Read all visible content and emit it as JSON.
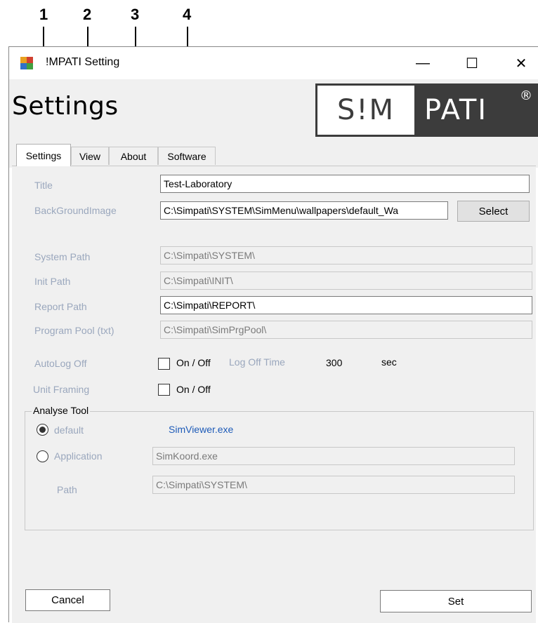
{
  "callouts": [
    "1",
    "2",
    "3",
    "4"
  ],
  "window": {
    "title": "!MPATI  Setting",
    "minimize": "—",
    "maximize": "☐",
    "close": "✕"
  },
  "header": {
    "title": "Settings",
    "logo_left": "S!M",
    "logo_right": "PATI",
    "logo_reg": "®"
  },
  "tabs": [
    "Settings",
    "View",
    "About",
    "Software"
  ],
  "form": {
    "title_label": "Title",
    "title_value": "Test-Laboratory",
    "bg_label": "BackGroundImage",
    "bg_value": "C:\\Simpati\\SYSTEM\\SimMenu\\wallpapers\\default_Wa",
    "select_button": "Select",
    "system_path_label": "System Path",
    "system_path_value": "C:\\Simpati\\SYSTEM\\",
    "init_path_label": "Init Path",
    "init_path_value": "C:\\Simpati\\INIT\\",
    "report_path_label": "Report Path",
    "report_path_value": "C:\\Simpati\\REPORT\\",
    "program_pool_label": "Program Pool (txt)",
    "program_pool_value": "C:\\Simpati\\SimPrgPool\\",
    "autolog_label": "AutoLog Off",
    "autolog_checkbox": "On / Off",
    "logoff_time_label": "Log Off Time",
    "logoff_time_value": "300",
    "logoff_unit": "sec",
    "unit_framing_label": "Unit Framing",
    "unit_framing_checkbox": "On / Off"
  },
  "analyse": {
    "legend": "Analyse Tool",
    "default_label": "default",
    "default_value": "SimViewer.exe",
    "application_label": "Application",
    "application_value": "SimKoord.exe",
    "path_label": "Path",
    "path_value": "C:\\Simpati\\SYSTEM\\"
  },
  "footer": {
    "cancel": "Cancel",
    "set": "Set"
  },
  "colors": {
    "label_gray": "#9aa7bd",
    "link_blue": "#1e5bb8",
    "logo_dark": "#3c3c3c"
  }
}
